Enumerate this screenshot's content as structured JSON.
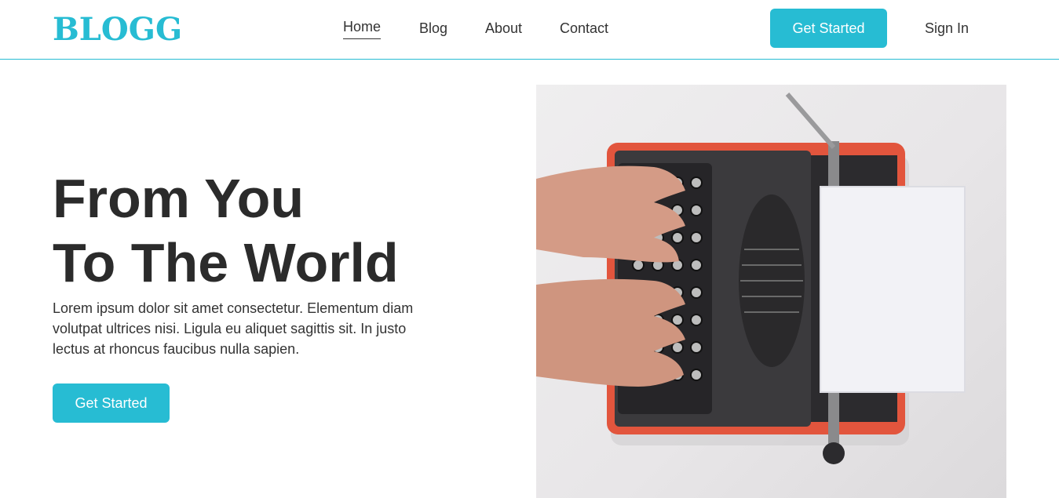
{
  "brand": {
    "logo": "BLOGG",
    "accent_color": "#27bcd3"
  },
  "nav": {
    "items": [
      {
        "label": "Home",
        "active": true
      },
      {
        "label": "Blog",
        "active": false
      },
      {
        "label": "About",
        "active": false
      },
      {
        "label": "Contact",
        "active": false
      }
    ]
  },
  "header": {
    "cta_label": "Get Started",
    "signin_label": "Sign In"
  },
  "hero": {
    "title_line1": "From You",
    "title_line2": "To The World",
    "description": "Lorem ipsum dolor sit amet consectetur. Elementum diam volutpat ultrices nisi. Ligula eu aliquet sagittis sit. In justo lectus at rhoncus faucibus nulla sapien.",
    "cta_label": "Get Started",
    "image": {
      "subject": "hands-typing-on-red-typewriter-image"
    }
  }
}
